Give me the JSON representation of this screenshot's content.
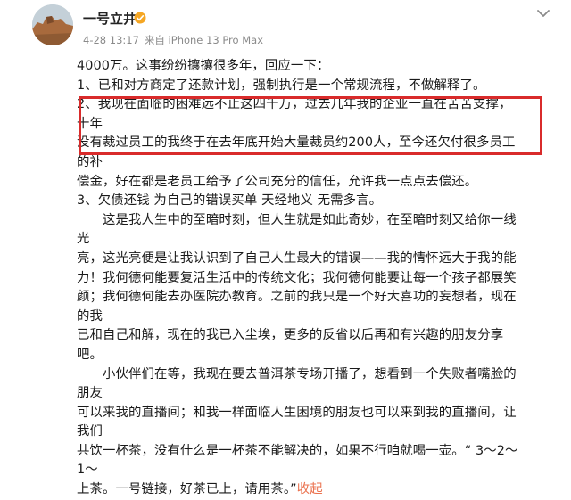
{
  "post": {
    "author": "一号立井",
    "date": "4-28 13:17",
    "source": "来自 iPhone 13 Pro Max",
    "lines": {
      "l1": "4000万。这事纷纷攘攘很多年，回应一下：",
      "l2": "1、已和对方商定了还款计划，强制执行是一个常规流程，不做解释了。",
      "l3": "2、我现在面临的困难远不止这四千万，过去几年我的企业一直在苦苦支撑，十年",
      "l4": "没有裁过员工的我终于在去年底开始大量裁员约200人，至今还欠付很多员工的补",
      "l5": "偿金，好在都是老员工给予了公司充分的信任，允许我一点点去偿还。",
      "l6": "3、欠债还钱 为自己的错误买单 天经地义 无需多言。",
      "l7": "这是我人生中的至暗时刻，但人生就是如此奇妙，在至暗时刻又给你一线光",
      "l8": "亮，这光亮便是让我认识到了自己人生最大的错误——我的情怀远大于我的能",
      "l9": "力！我何德何能要复活生活中的传统文化；我何德何能要让每一个孩子都展笑",
      "l10": "颜；我何德何能去办医院办教育。之前的我只是一个好大喜功的妄想者，现在的我",
      "l11": "已和自己和解，现在的我已入尘埃，更多的反省以后再和有兴趣的朋友分享吧。",
      "l12": "小伙伴们在等，我现在要去普洱茶专场开播了，想看到一个失败者嘴脸的朋友",
      "l13": "可以来我的直播间；和我一样面临人生困境的朋友也可以来到我的直播间，让我们",
      "l14": "共饮一杯茶，没有什么是一杯茶不能解决的，如果不行咱就喝一壶。“ 3～2～1～",
      "l15": "上茶。一号链接，好茶已上，请用茶。”",
      "collapse": "收起"
    }
  },
  "icons": {
    "verified": "verified-badge-icon",
    "more": "chevron-down-icon"
  },
  "colors": {
    "highlight_border": "#d92b2b",
    "link": "#eb7350",
    "verified": "#f5a623",
    "meta_text": "#8a8a8a"
  }
}
